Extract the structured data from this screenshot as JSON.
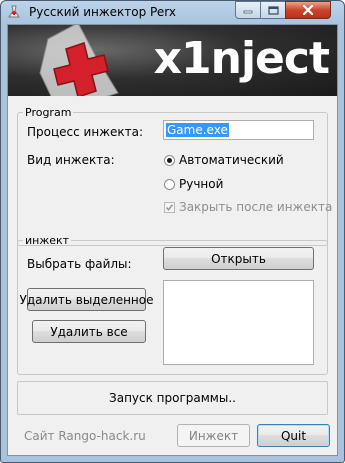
{
  "window": {
    "title": "Русский инжектор Perx"
  },
  "banner": {
    "text": "x1nject"
  },
  "program_group": {
    "legend": "Program",
    "process_label": "Процесс инжекта:",
    "process_value": "Game.exe",
    "type_label": "Вид инжекта:",
    "options": [
      {
        "label": "Автоматический",
        "selected": true
      },
      {
        "label": "Ручной",
        "selected": false
      }
    ],
    "close_after": {
      "label": "Закрыть после инжекта",
      "checked": true,
      "enabled": false
    }
  },
  "inject_group": {
    "legend": "инжект",
    "choose_files_label": "Выбрать файлы:",
    "open_button": "Открыть",
    "delete_selected_button": "Удалить выделенное",
    "delete_all_button": "Удалить все"
  },
  "status": {
    "text": "Запуск программы.."
  },
  "footer": {
    "site_text": "Сайт Rango-hack.ru",
    "inject_button": "Инжект",
    "quit_button": "Quit"
  }
}
